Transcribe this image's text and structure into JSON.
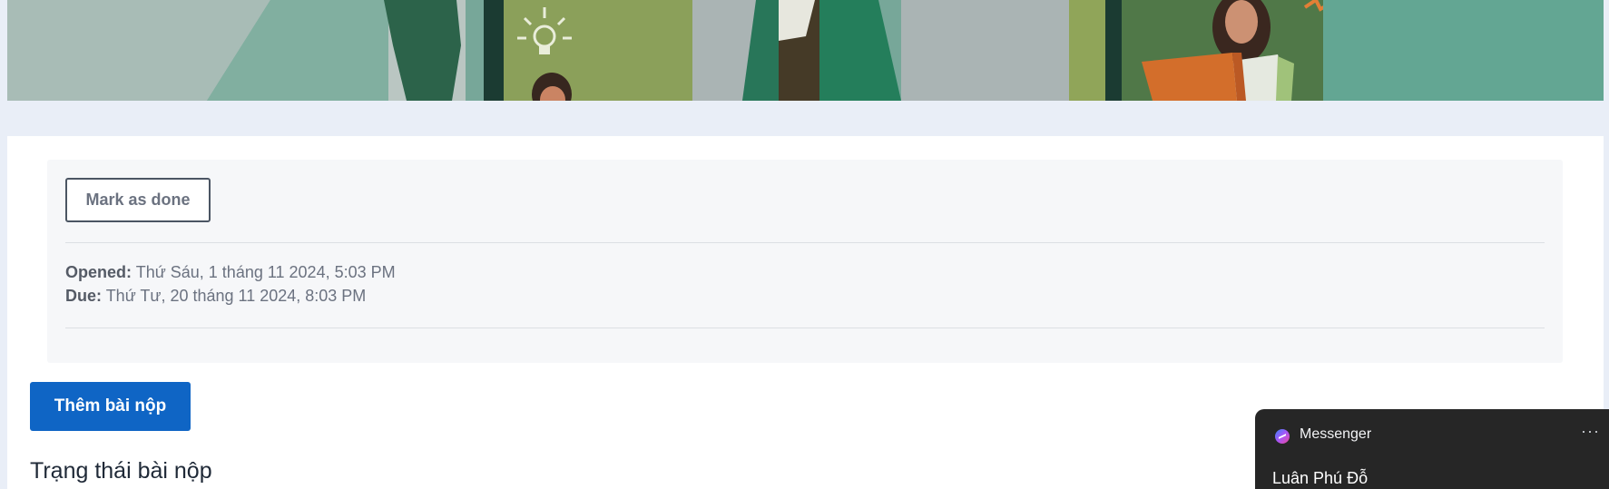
{
  "activity": {
    "mark_done_label": "Mark as done",
    "opened_label": "Opened:",
    "opened_value": "Thứ Sáu, 1 tháng 11 2024, 5:03 PM",
    "due_label": "Due:",
    "due_value": "Thứ Tư, 20 tháng 11 2024, 8:03 PM"
  },
  "submission": {
    "add_button_label": "Thêm bài nộp",
    "status_heading": "Trạng thái bài nộp"
  },
  "messenger": {
    "app_name": "Messenger",
    "more_icon": "more-horizontal-icon",
    "contact_name": "Luân Phú Đỗ"
  },
  "colors": {
    "page_background": "#e9eef7",
    "primary_button": "#0f65c5",
    "banner_teal": "#7aa99a",
    "messenger_bg": "#262626"
  }
}
